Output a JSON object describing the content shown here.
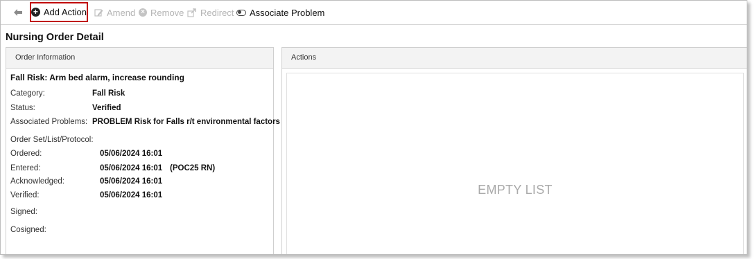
{
  "toolbar": {
    "add_action": "Add Action",
    "amend": "Amend",
    "remove": "Remove",
    "redirect": "Redirect",
    "associate_problem": "Associate Problem"
  },
  "page": {
    "title": "Nursing Order Detail"
  },
  "order_info": {
    "header": "Order Information",
    "order_title": "Fall Risk: Arm bed alarm, increase rounding",
    "category_label": "Category:",
    "category_value": "Fall Risk",
    "status_label": "Status:",
    "status_value": "Verified",
    "problems_label": "Associated Problems:",
    "problems_value": "PROBLEM Risk for Falls r/t environmental factors",
    "order_set_label": "Order Set/List/Protocol:",
    "ordered_label": "Ordered:",
    "ordered_value": "05/06/2024 16:01",
    "entered_label": "Entered:",
    "entered_value": "05/06/2024 16:01",
    "entered_by": "(POC25 RN)",
    "acknowledged_label": "Acknowledged:",
    "acknowledged_value": "05/06/2024 16:01",
    "verified_label": "Verified:",
    "verified_value": "05/06/2024 16:01",
    "signed_label": "Signed:",
    "cosigned_label": "Cosigned:"
  },
  "actions": {
    "header": "Actions",
    "empty_text": "EMPTY LIST"
  },
  "colors": {
    "highlight": "#c00000",
    "disabled_text": "#b4b4b4"
  }
}
